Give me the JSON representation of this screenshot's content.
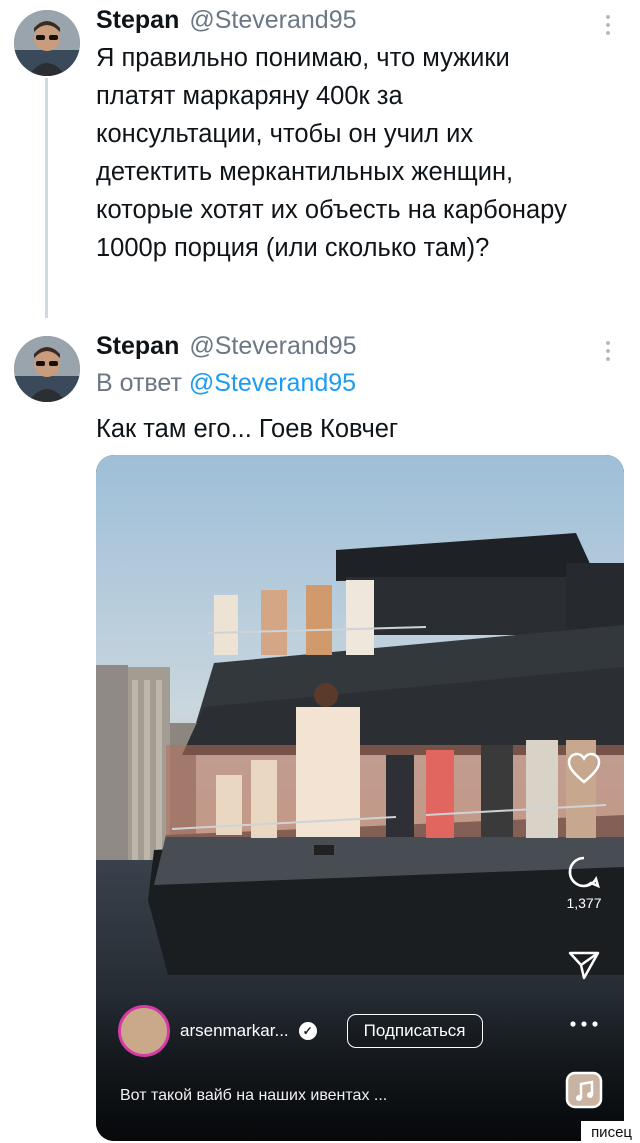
{
  "tweets": [
    {
      "name": "Stepan",
      "handle": "@Steverand95",
      "text": "Я правильно понимаю, что мужики\nплатят маркаряну 400к за\nконсультации, чтобы он учил их\nдетектить меркантильных женщин,\nкоторые хотят их объесть на карбонару\n1000р порция (или сколько там)?"
    },
    {
      "name": "Stepan",
      "handle": "@Steverand95",
      "reply_prefix": "В ответ",
      "reply_to": "@Steverand95",
      "text": "Как там его... Гоев Ковчег"
    }
  ],
  "video": {
    "comments_count": "1,377",
    "account_name": "arsenmarkar...",
    "follow_label": "Подписаться",
    "caption": "Вот такой вайб на наших ивентах ..."
  },
  "icons": {
    "more": "more-vertical-icon",
    "like": "heart-icon",
    "comment": "comment-icon",
    "share": "send-icon",
    "options": "more-horizontal-icon",
    "audio": "audio-icon"
  },
  "watermark": "писец",
  "colors": {
    "link": "#1d9bf0",
    "handle": "#6b7785",
    "thread_line": "#cfd9de"
  }
}
